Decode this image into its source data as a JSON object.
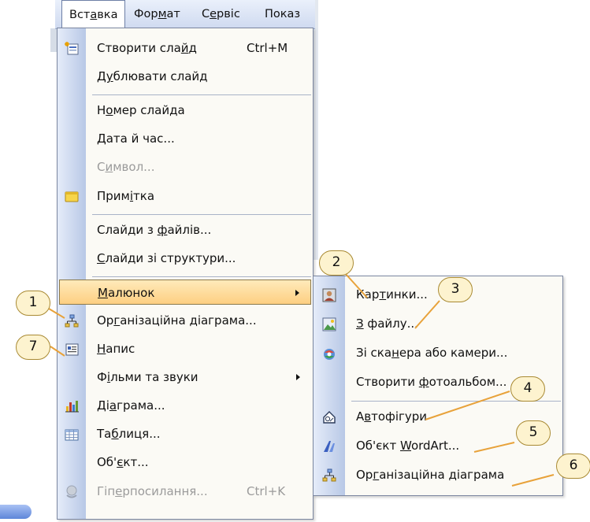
{
  "menubar": {
    "items": [
      {
        "pre": "Вст",
        "u": "а",
        "post": "вка"
      },
      {
        "pre": "Фор",
        "u": "м",
        "post": "ат"
      },
      {
        "pre": "С",
        "u": "е",
        "post": "рвіс"
      },
      {
        "pre": "",
        "u": "",
        "post": "Показ"
      }
    ]
  },
  "insert_menu": {
    "items": [
      {
        "pre": "Створити сла",
        "u": "й",
        "post": "д",
        "shortcut": "Ctrl+M",
        "icon": "new-slide-icon"
      },
      {
        "pre": "Д",
        "u": "у",
        "post": "блювати слайд"
      },
      {
        "pre": "Н",
        "u": "о",
        "post": "мер слайда"
      },
      {
        "pre": "",
        "u": "Д",
        "post": "ата й час..."
      },
      {
        "pre": "С",
        "u": "и",
        "post": "мвол...",
        "disabled": true
      },
      {
        "pre": "Прим",
        "u": "і",
        "post": "тка",
        "icon": "comment-icon"
      },
      {
        "pre": "Слайди з ",
        "u": "ф",
        "post": "айлів..."
      },
      {
        "pre": "",
        "u": "С",
        "post": "лайди зі структури..."
      },
      {
        "pre": "",
        "u": "М",
        "post": "алюнок",
        "submenu": true,
        "highlighted": true
      },
      {
        "pre": "Ор",
        "u": "г",
        "post": "анізаційна діаграма...",
        "icon": "org-chart-icon"
      },
      {
        "pre": "",
        "u": "Н",
        "post": "апис",
        "icon": "text-box-icon"
      },
      {
        "pre": "Ф",
        "u": "і",
        "post": "льми та звуки",
        "submenu": true
      },
      {
        "pre": "Ді",
        "u": "а",
        "post": "грама...",
        "icon": "chart-icon"
      },
      {
        "pre": "Та",
        "u": "б",
        "post": "лиця...",
        "icon": "table-icon"
      },
      {
        "pre": "Об'",
        "u": "є",
        "post": "кт..."
      },
      {
        "pre": "Гіп",
        "u": "е",
        "post": "рпосилання...",
        "shortcut": "Ctrl+K",
        "disabled": true,
        "icon": "hyperlink-icon"
      }
    ]
  },
  "picture_submenu": {
    "items": [
      {
        "pre": "Кар",
        "u": "т",
        "post": "инки...",
        "icon": "clip-art-icon"
      },
      {
        "pre": "",
        "u": "З",
        "post": " файлу...",
        "icon": "from-file-icon"
      },
      {
        "pre": "Зі ска",
        "u": "н",
        "post": "ера або камери...",
        "icon": "scanner-camera-icon"
      },
      {
        "pre": "Створити ",
        "u": "ф",
        "post": "отоальбом...",
        "icon": ""
      },
      {
        "pre": "А",
        "u": "в",
        "post": "тофігури",
        "icon": "autoshapes-icon"
      },
      {
        "pre": "Об'єкт ",
        "u": "W",
        "post": "ordArt...",
        "icon": "wordart-icon"
      },
      {
        "pre": "Ор",
        "u": "г",
        "post": "анізаційна діаграма",
        "icon": "org-chart-icon"
      }
    ]
  },
  "callouts": [
    "1",
    "2",
    "3",
    "4",
    "5",
    "6",
    "7"
  ],
  "colors": {
    "menu_bg": "#fbfaf5",
    "strip_light": "#e5ecf9",
    "strip_dark": "#b8c8e6",
    "highlight_top": "#ffeaba",
    "highlight_bottom": "#fdcf82",
    "callout_fill": "#fdf3cf",
    "leader_line": "#e8a23a"
  }
}
